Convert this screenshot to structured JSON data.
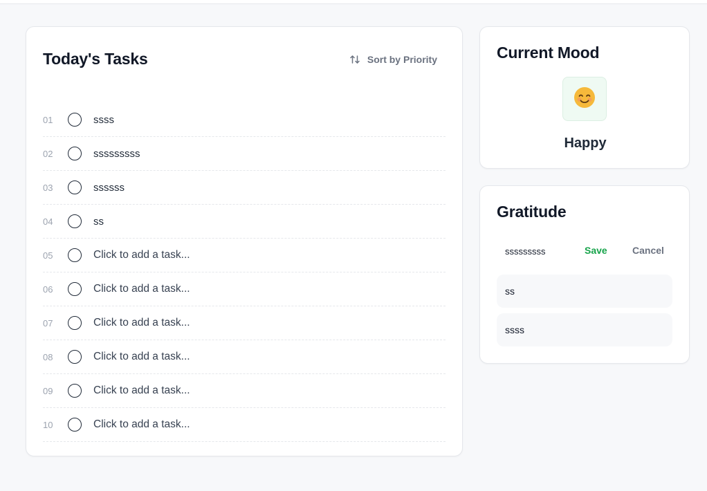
{
  "tasks": {
    "title": "Today's Tasks",
    "sort_label": "Sort by Priority",
    "sort_icon": "sort-arrows-icon",
    "items": [
      {
        "num": "01",
        "text": "ssss",
        "placeholder": false
      },
      {
        "num": "02",
        "text": "sssssssss",
        "placeholder": false
      },
      {
        "num": "03",
        "text": "ssssss",
        "placeholder": false
      },
      {
        "num": "04",
        "text": "ss",
        "placeholder": false
      },
      {
        "num": "05",
        "text": "Click to add a task...",
        "placeholder": true
      },
      {
        "num": "06",
        "text": "Click to add a task...",
        "placeholder": true
      },
      {
        "num": "07",
        "text": "Click to add a task...",
        "placeholder": true
      },
      {
        "num": "08",
        "text": "Click to add a task...",
        "placeholder": true
      },
      {
        "num": "09",
        "text": "Click to add a task...",
        "placeholder": true
      },
      {
        "num": "10",
        "text": "Click to add a task...",
        "placeholder": true
      }
    ]
  },
  "mood": {
    "title": "Current Mood",
    "emoji_icon": "smiling-face-icon",
    "label": "Happy"
  },
  "gratitude": {
    "title": "Gratitude",
    "input_value": "sssssssss",
    "save_label": "Save",
    "cancel_label": "Cancel",
    "entries": [
      "ss",
      "ssss"
    ]
  },
  "colors": {
    "save": "#16a34a",
    "muted": "#6b7280",
    "mood_bg": "#effaf3",
    "emoji": "#f6b93b"
  }
}
